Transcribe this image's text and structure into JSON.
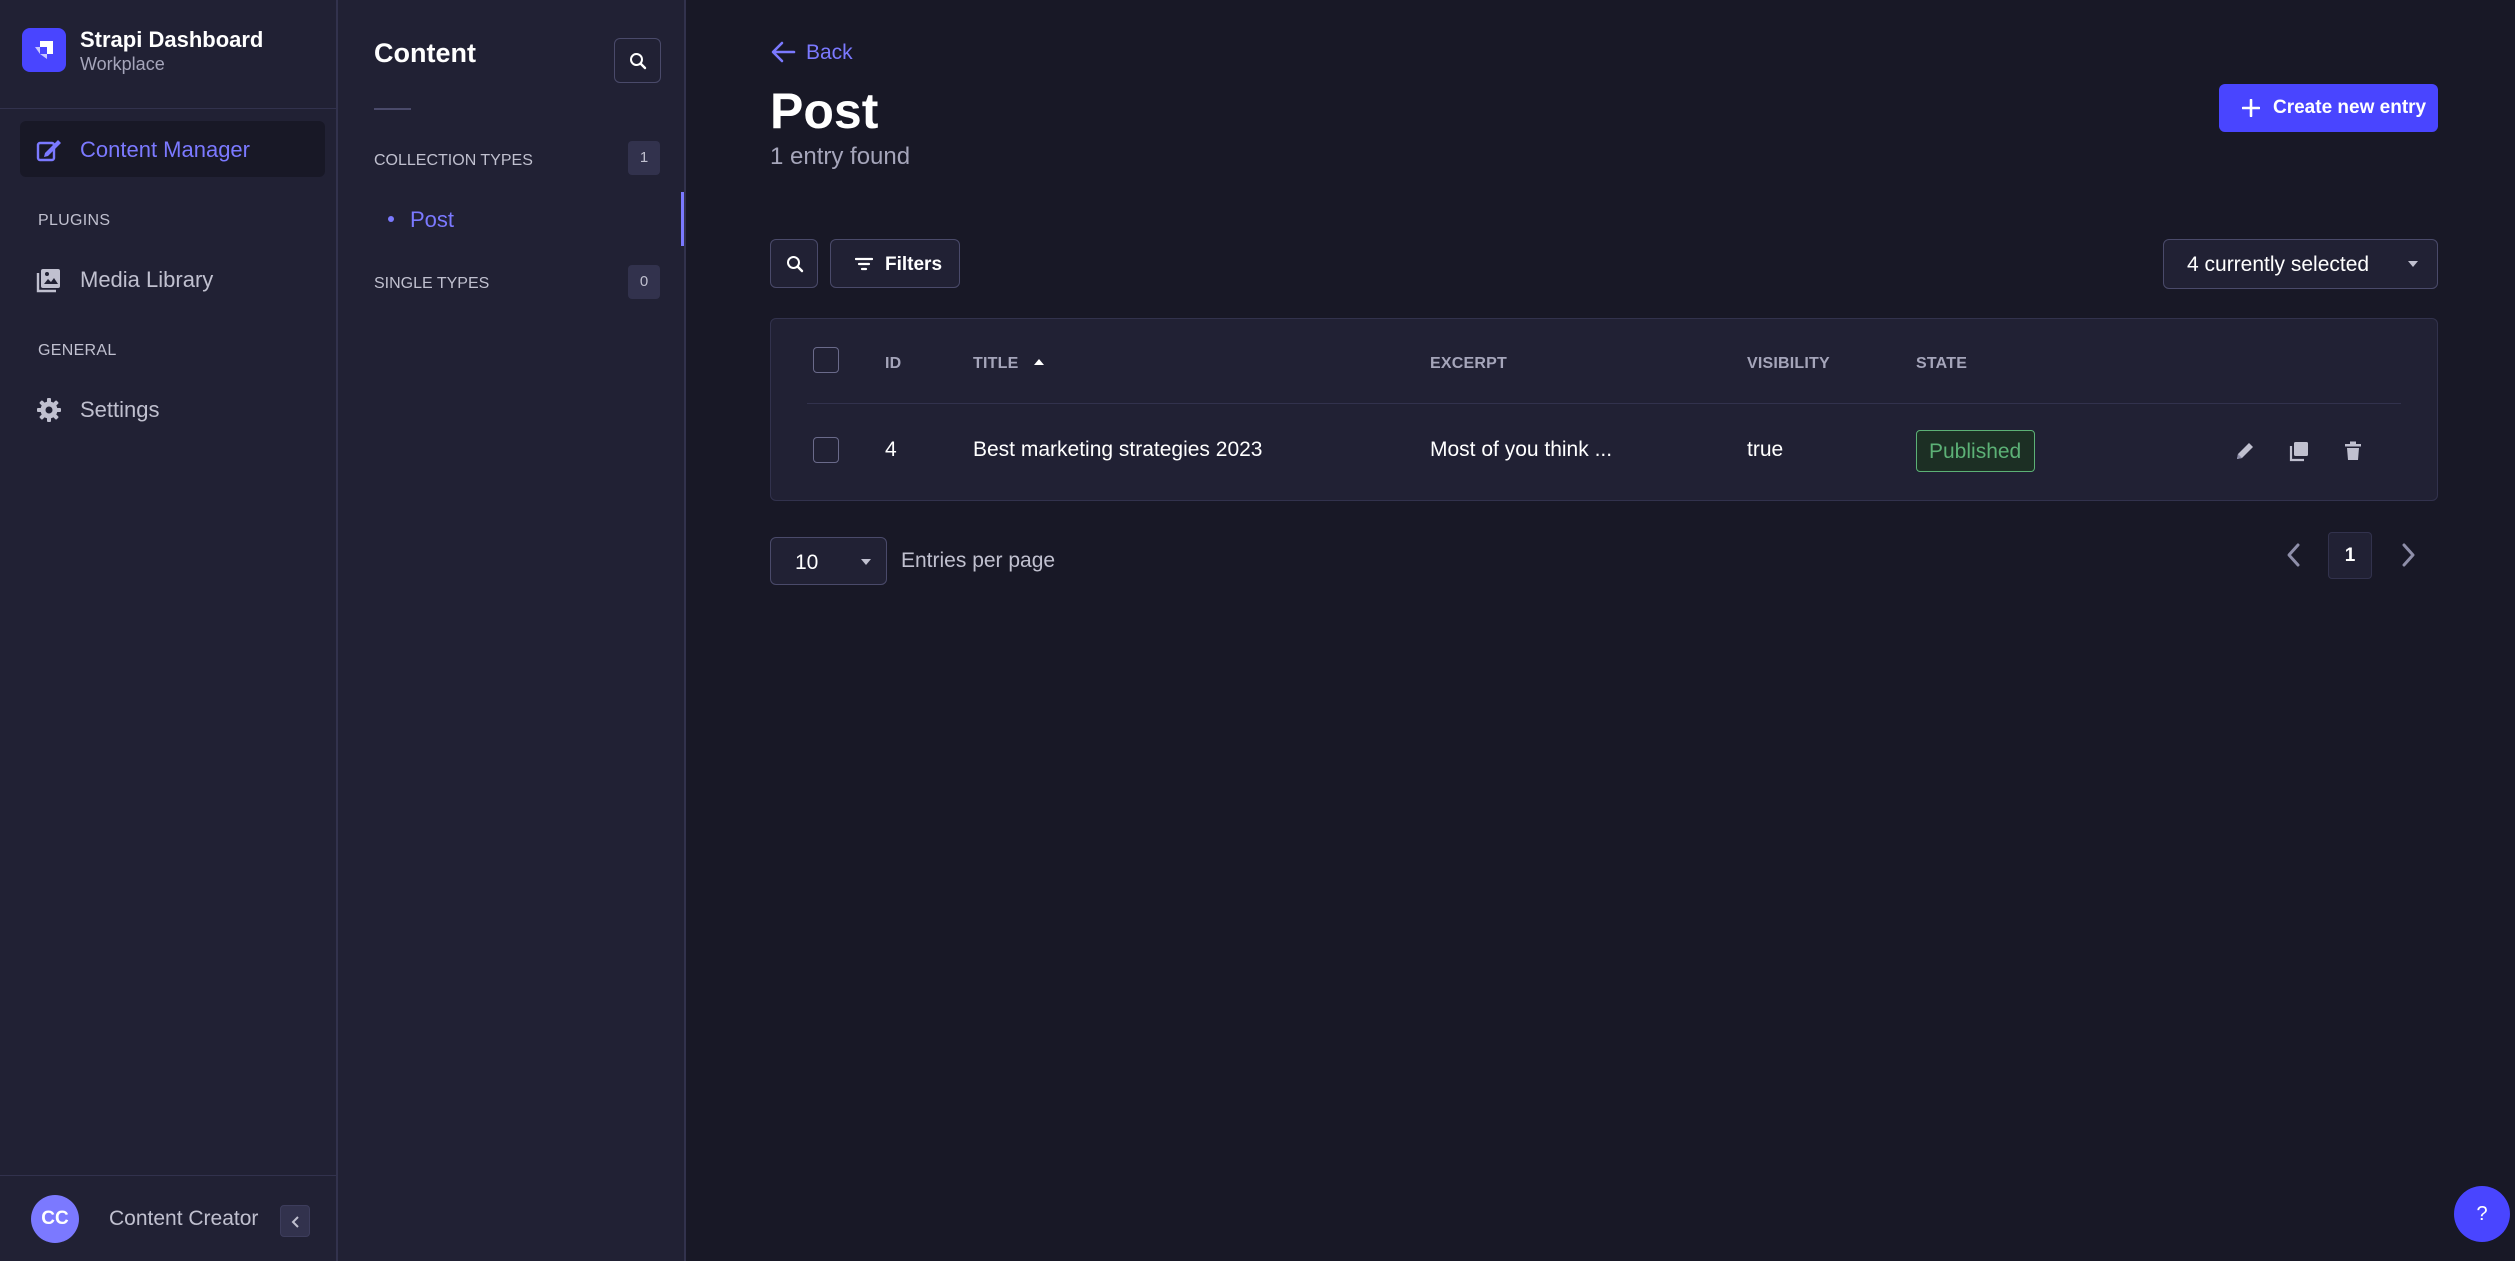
{
  "colors": {
    "background": "#181826",
    "panel": "#212134",
    "border": "#32324d",
    "accent": "#4945ff",
    "accent_text": "#7b79ff",
    "success": "#5cb176"
  },
  "brand": {
    "title": "Strapi Dashboard",
    "subtitle": "Workplace",
    "logo_icon": "strapi-logo"
  },
  "mainnav": {
    "content_manager": {
      "label": "Content Manager",
      "icon": "feather-icon"
    },
    "plugins_section": "PLUGINS",
    "media_library": {
      "label": "Media Library",
      "icon": "image-icon"
    },
    "general_section": "GENERAL",
    "settings": {
      "label": "Settings",
      "icon": "gear-icon"
    }
  },
  "user": {
    "initials": "CC",
    "name": "Content Creator"
  },
  "subnav": {
    "title": "Content",
    "collection_types": {
      "label": "COLLECTION TYPES",
      "count": "1"
    },
    "items": [
      {
        "label": "Post"
      }
    ],
    "single_types": {
      "label": "SINGLE TYPES",
      "count": "0"
    }
  },
  "header": {
    "back_label": "Back",
    "title": "Post",
    "subtitle": "1 entry found",
    "create_label": "Create new entry"
  },
  "toolbar": {
    "filters_label": "Filters",
    "columns_selected": "4 currently selected"
  },
  "table": {
    "headers": {
      "id": "ID",
      "title": "TITLE",
      "excerpt": "EXCERPT",
      "visibility": "VISIBILITY",
      "state": "STATE"
    },
    "sort": {
      "column": "TITLE",
      "direction": "ascending"
    },
    "rows": [
      {
        "id": "4",
        "title": "Best marketing strategies 2023",
        "excerpt": "Most of you think ...",
        "visibility": "true",
        "state": "Published"
      }
    ]
  },
  "pagination": {
    "per_page": "10",
    "per_page_label": "Entries per page",
    "current_page": "1"
  },
  "help": {
    "label": "?"
  }
}
